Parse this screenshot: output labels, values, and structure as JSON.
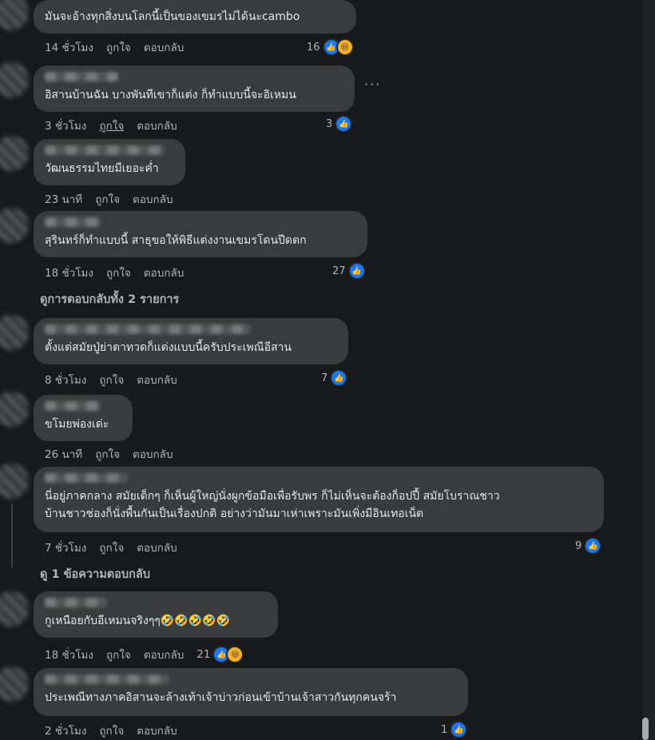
{
  "comments": [
    {
      "text": "มันจะอ้างทุกสิ่งบนโลกนี้เป็นของเขมรไม่ได้นะcambo",
      "time": "14 ชั่วโมง",
      "like": "ถูกใจ",
      "reply": "ตอบกลับ",
      "count": "16",
      "reactions": [
        "like",
        "haha"
      ]
    },
    {
      "text": "อิสานบ้านฉัน บางพันทีเขาก็แต่ง ก็ทำแบบนี้จะอิเหมน",
      "time": "3 ชั่วโมง",
      "like": "ถูกใจ",
      "reply": "ตอบกลับ",
      "count": "3",
      "reactions": [
        "like"
      ]
    },
    {
      "text": "วัฒนธรรมไทยมีเยอะค่ำ",
      "time": "23 นาที",
      "like": "ถูกใจ",
      "reply": "ตอบกลับ",
      "count": "",
      "reactions": []
    },
    {
      "text": "สุรินทร์ก็ทำแบบนี้ สาธุขอให้พิธีแต่งงานเขมรโดนปีดตก",
      "time": "18 ชั่วโมง",
      "like": "ถูกใจ",
      "reply": "ตอบกลับ",
      "count": "27",
      "reactions": [
        "like"
      ],
      "replies_link": "ดูการตอบกลับทั้ง 2 รายการ"
    },
    {
      "text": "ตั้งแต่สมัยปู่ย่าตาทวดก็แต่งแบบนี้ครับประเพณีอีสาน",
      "time": "8 ชั่วโมง",
      "like": "ถูกใจ",
      "reply": "ตอบกลับ",
      "count": "7",
      "reactions": [
        "like"
      ]
    },
    {
      "text": "ขโมยพ่องเด่ะ",
      "time": "26 นาที",
      "like": "ถูกใจ",
      "reply": "ตอบกลับ",
      "count": "",
      "reactions": []
    },
    {
      "text": "นี่อยู่ภาคกลาง สมัยเด็กๆ ก็เห็นผู้ใหญ่นั่งผูกข้อมือเพื่อรับพร ก็ไม่เห็นจะต้องก็อปปี้ สมัยโบราณชาว\nบ้านชาวช่องก็นั่งพื้นกันเป็นเรื่องปกติ อย่างว่ามันมาเห่าเพราะมันเพิ่งมีอินเทอเน็ต",
      "time": "7 ชั่วโมง",
      "like": "ถูกใจ",
      "reply": "ตอบกลับ",
      "count": "9",
      "reactions": [
        "like"
      ],
      "replies_link": "ดู 1 ข้อความตอบกลับ"
    },
    {
      "text": "กูเหนือยกับอีเหมนจริงๆๆ🤣🤣🤣🤣🤣",
      "time": "18 ชั่วโมง",
      "like": "ถูกใจ",
      "reply": "ตอบกลับ",
      "count": "21",
      "reactions": [
        "like",
        "haha"
      ]
    },
    {
      "text": "ประเพณีทางภาคอิสานจะล้างเท้าเจ้าบ่าวก่อนเข้าบ้านเจ้าสาวกันทุกคนจร้า",
      "time": "2 ชั่วโมง",
      "like": "ถูกใจ",
      "reply": "ตอบกลับ",
      "count": "1",
      "reactions": [
        "like"
      ]
    }
  ],
  "icons": {
    "like": "thumbs-up-icon",
    "haha": "laughing-face-icon",
    "more": "more-options-icon"
  },
  "colors": {
    "background": "#18191a",
    "bubble": "#3a3b3c",
    "accent": "#1877f2",
    "muted": "#b0b3b8"
  }
}
